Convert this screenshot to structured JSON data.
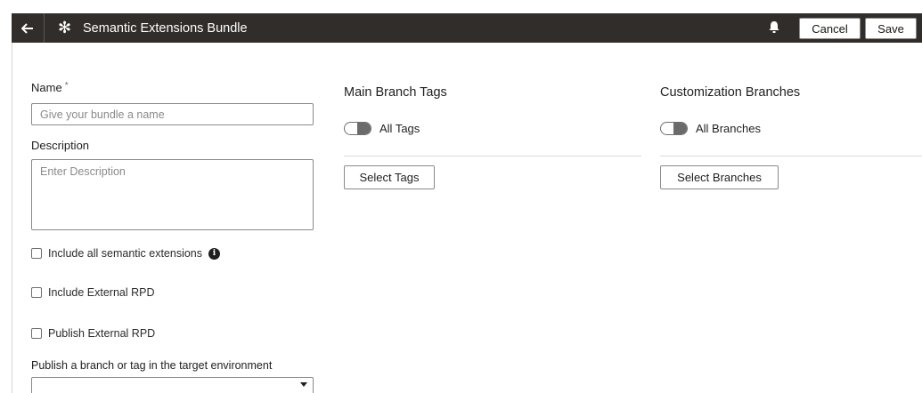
{
  "header": {
    "back_icon": "arrow-left-icon",
    "app_icon": "snowflake-icon",
    "title": "Semantic Extensions Bundle",
    "bell_icon": "bell-icon",
    "cancel_label": "Cancel",
    "save_label": "Save",
    "background": "#312d2a"
  },
  "form": {
    "name_label": "Name",
    "name_required_mark": "*",
    "name_placeholder": "Give your bundle a name",
    "description_label": "Description",
    "description_placeholder": "Enter Description",
    "include_all_label": "Include all semantic extensions",
    "include_all_checked": false,
    "info_icon": "info-icon",
    "include_rpd_label": "Include External RPD",
    "include_rpd_checked": false,
    "publish_rpd_label": "Publish External RPD",
    "publish_rpd_checked": false,
    "publish_branch_label": "Publish a branch or tag in the target environment",
    "publish_branch_value": ""
  },
  "tags": {
    "title": "Main Branch Tags",
    "toggle_label": "All Tags",
    "toggle_on": false,
    "button_label": "Select Tags"
  },
  "branches": {
    "title": "Customization Branches",
    "toggle_label": "All Branches",
    "toggle_on": false,
    "button_label": "Select Branches"
  }
}
